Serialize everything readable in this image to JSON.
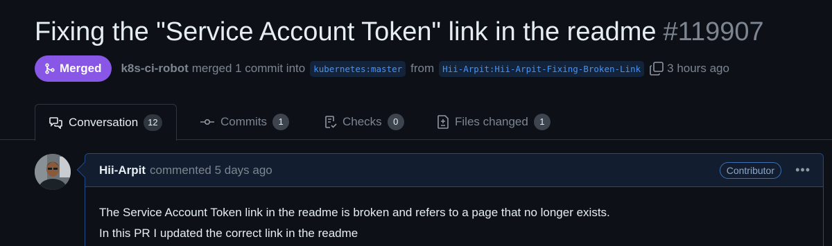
{
  "pr": {
    "title": "Fixing the \"Service Account Token\" link in the readme",
    "number": "#119907",
    "status": "Merged",
    "author": "k8s-ci-robot",
    "merged_text": "merged 1 commit into",
    "base_branch": "kubernetes:master",
    "from_text": "from",
    "head_branch": "Hii-Arpit:Hii-Arpit-Fixing-Broken-Link",
    "time": "3 hours ago"
  },
  "tabs": [
    {
      "label": "Conversation",
      "count": "12",
      "icon": "comment-discussion-icon",
      "active": true
    },
    {
      "label": "Commits",
      "count": "1",
      "icon": "commit-icon",
      "active": false
    },
    {
      "label": "Checks",
      "count": "0",
      "icon": "checklist-icon",
      "active": false
    },
    {
      "label": "Files changed",
      "count": "1",
      "icon": "file-diff-icon",
      "active": false
    }
  ],
  "comment": {
    "author": "Hii-Arpit",
    "when": "commented 5 days ago",
    "role": "Contributor",
    "body_line1": "The Service Account Token link in the readme is broken and refers to a page that no longer exists.",
    "body_line2": "In this PR I updated the correct link in the readme"
  },
  "colors": {
    "background": "#0d1117",
    "merged_badge": "#8957e5",
    "branch_text": "#4493f8",
    "comment_border": "#1f4b8a",
    "muted_text": "#7d8590"
  }
}
